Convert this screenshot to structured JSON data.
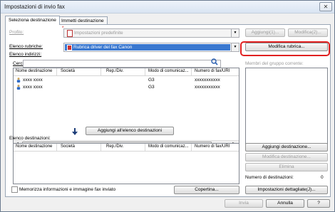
{
  "window": {
    "title": "Impostazioni di invio fax",
    "close_label": "✕"
  },
  "tabs": [
    {
      "label": "Seleziona destinazione"
    },
    {
      "label": "Immetti destinazione"
    }
  ],
  "profile": {
    "label": "Profilo:",
    "value": "Impostazioni predefinite",
    "add_button": "Aggiungi(1)...",
    "edit_button": "Modifica(2)..."
  },
  "address_book": {
    "label": "Elenco rubriche:",
    "value": "Rubrica driver del fax Canon",
    "edit_button": "Modifica rubrica...",
    "addresses_label": "Elenco indirizzi:",
    "search_label": "Cerca:"
  },
  "group_members_label": "Membri del gruppo corrente:",
  "top_table": {
    "columns": [
      "Nome destinazione",
      "Società",
      "Rep./Div.",
      "Modo di comunicaz...",
      "Numero di fax/URI"
    ],
    "rows": [
      {
        "name": "xxxx xxxx",
        "mode": "G3",
        "number": "xxxxxxxxxxx"
      },
      {
        "name": "xxxx xxxx",
        "mode": "G3",
        "number": "xxxxxxxxxxx"
      }
    ]
  },
  "add_to_list_button": "Aggiungi all'elenco destinazioni",
  "destinations": {
    "label": "Elenco destinazioni:",
    "columns": [
      "Nome destinazione",
      "Società",
      "Rep./Div.",
      "Modo di comunicaz...",
      "Numero di fax/URI"
    ],
    "add_button": "Aggiungi destinazione...",
    "edit_button": "Modifica destinazione...",
    "delete_button": "Elimina",
    "count_label": "Numero di destinazioni:",
    "count": "0"
  },
  "footer": {
    "remember_label": "Memorizza informazioni e immagine fax inviato",
    "cover_button": "Copertina...",
    "detail_button": "Impostazioni dettagliate(J)...",
    "send_button": "Invia",
    "cancel_button": "Annulla",
    "help_button": "?"
  }
}
